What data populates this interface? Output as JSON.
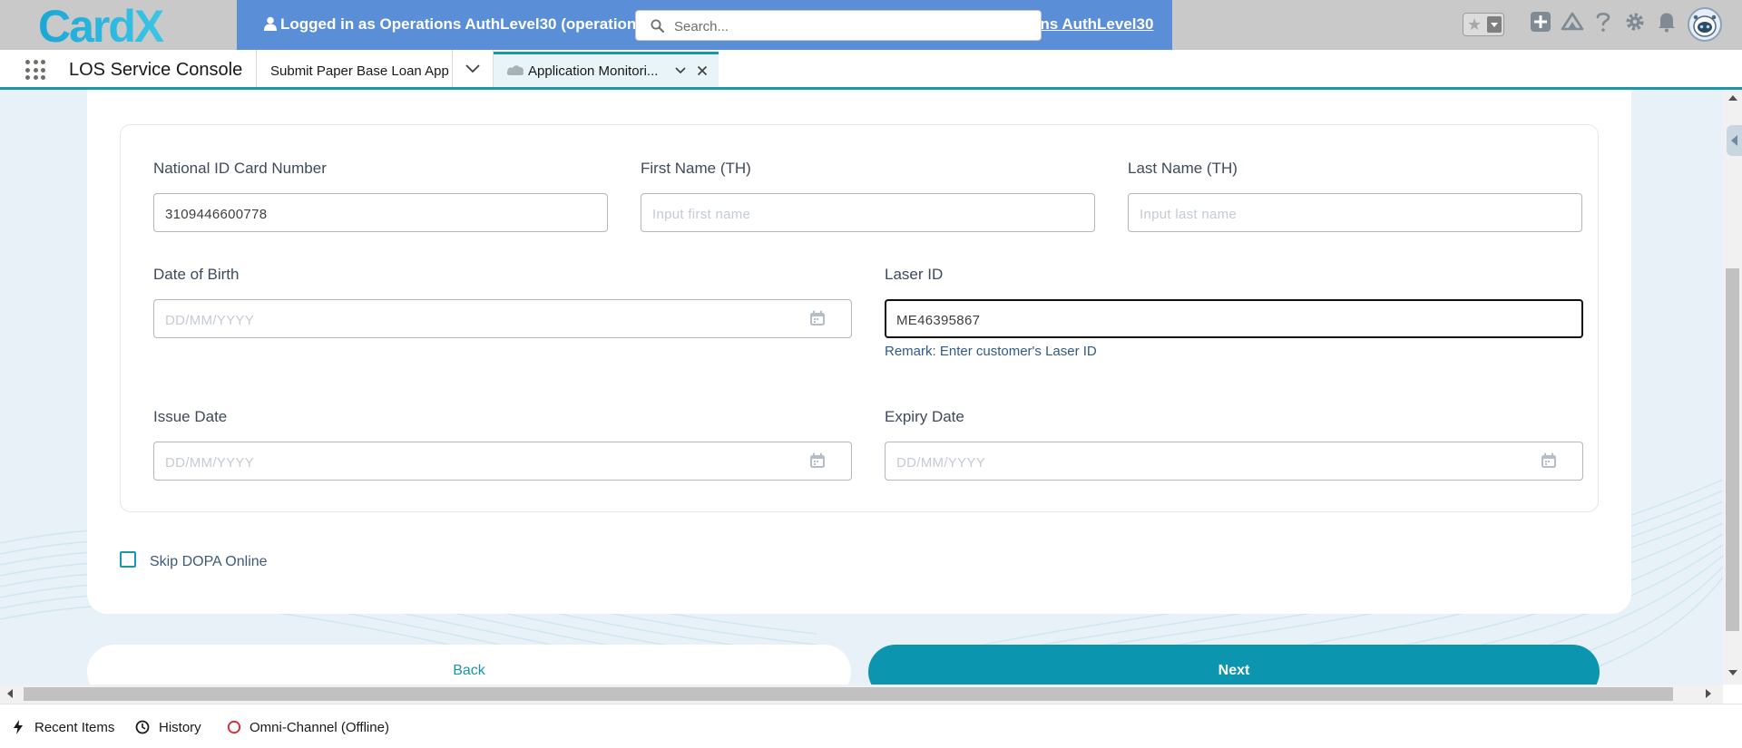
{
  "header": {
    "logo_text": "CardX",
    "impersonation_text": "Logged in as Operations AuthLevel30 (operations",
    "impersonation_link": "ons AuthLevel30",
    "search_placeholder": "Search...",
    "icons": [
      "favorites-star-icon",
      "add-icon",
      "trailhead-icon",
      "help-icon",
      "setup-gear-icon",
      "notification-bell-icon",
      "user-avatar"
    ]
  },
  "tabbar": {
    "app_name": "LOS Service Console",
    "tabs": [
      {
        "label": "Submit Paper Base Loan App",
        "active": false
      },
      {
        "label": "Application Monitori...",
        "active": true
      }
    ]
  },
  "form": {
    "national_id": {
      "label": "National ID Card Number",
      "value": "3109446600778",
      "placeholder": ""
    },
    "first_name": {
      "label": "First Name (TH)",
      "value": "",
      "placeholder": "Input first name"
    },
    "last_name": {
      "label": "Last Name (TH)",
      "value": "",
      "placeholder": "Input last name"
    },
    "dob": {
      "label": "Date of Birth",
      "value": "",
      "placeholder": "DD/MM/YYYY"
    },
    "laser_id": {
      "label": "Laser ID",
      "value": "ME46395867",
      "placeholder": "",
      "remark": "Remark: Enter customer's Laser ID"
    },
    "issue_date": {
      "label": "Issue Date",
      "value": "",
      "placeholder": "DD/MM/YYYY"
    },
    "expiry_date": {
      "label": "Expiry Date",
      "value": "",
      "placeholder": "DD/MM/YYYY"
    },
    "skip_dopa": {
      "label": "Skip DOPA Online",
      "checked": false
    }
  },
  "buttons": {
    "back": "Back",
    "next": "Next"
  },
  "utility_bar": {
    "recent_items": "Recent Items",
    "history": "History",
    "omni_channel": "Omni-Channel (Offline)"
  },
  "colors": {
    "header_bg": "#c9c9c9",
    "impersonation_bg": "#5a8fd8",
    "accent": "#1b96a8",
    "next_button": "#0c95ae",
    "content_bg": "#e9f1f8",
    "omni_offline": "#e0212b"
  }
}
